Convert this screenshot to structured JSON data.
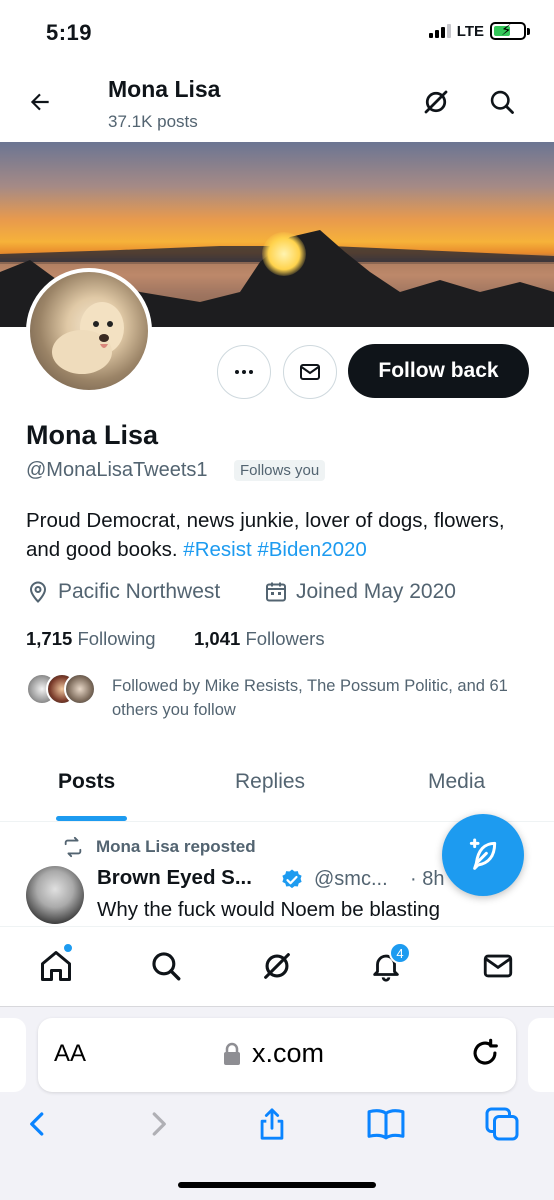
{
  "status_bar": {
    "time": "5:19",
    "network": "LTE"
  },
  "header": {
    "title": "Mona Lisa",
    "subtitle": "37.1K posts"
  },
  "profile": {
    "name": "Mona Lisa",
    "handle": "@MonaLisaTweets1",
    "follows_you_badge": "Follows you",
    "bio_text": "Proud Democrat, news junkie, lover of dogs, flowers, and good books. ",
    "bio_hashtags": [
      "#Resist",
      "#Biden2020"
    ],
    "location": "Pacific Northwest",
    "joined": "Joined May 2020",
    "following_count": "1,715",
    "following_label": "Following",
    "followers_count": "1,041",
    "followers_label": "Followers",
    "followed_by": "Followed by Mike Resists, The Possum Politic, and 61 others you follow",
    "follow_button": "Follow back"
  },
  "tabs": [
    {
      "label": "Posts",
      "active": true
    },
    {
      "label": "Replies",
      "active": false
    },
    {
      "label": "Media",
      "active": false
    }
  ],
  "post": {
    "repost_by": "Mona Lisa reposted",
    "author": "Brown Eyed S...",
    "handle": "@smc...",
    "time": "· 8h",
    "text": "Why the fuck would Noem be blasting"
  },
  "bottom_nav": {
    "notifications_count": "4"
  },
  "browser": {
    "aa_label": "AA",
    "url": "x.com"
  },
  "colors": {
    "accent": "#1d9bf0",
    "text": "#0f1419",
    "muted": "#536471"
  }
}
